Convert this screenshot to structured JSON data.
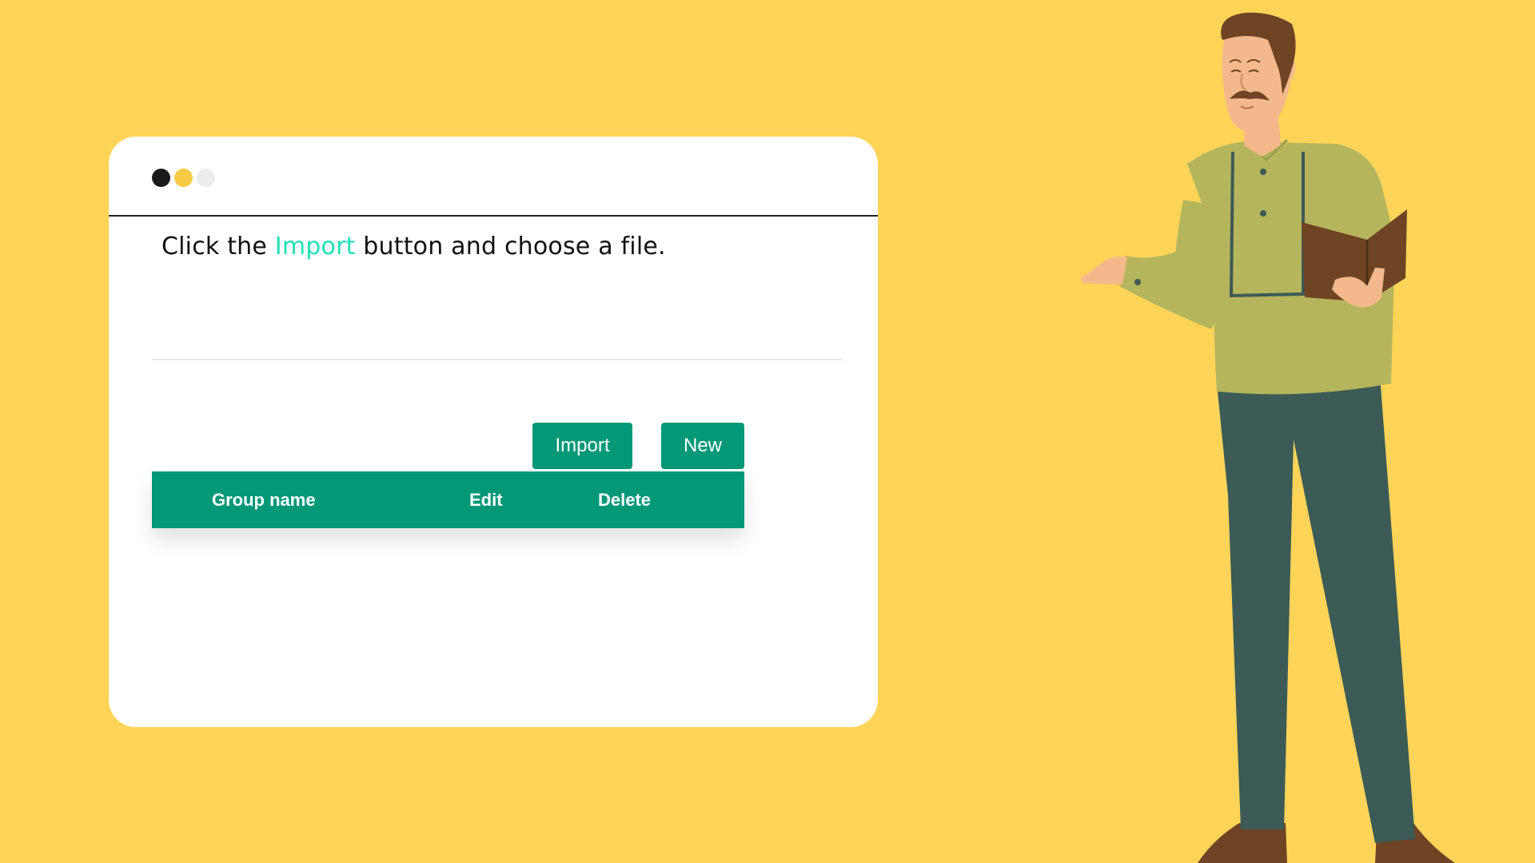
{
  "instruction": {
    "before": "Click the ",
    "highlight": "Import",
    "after": " button and choose a file."
  },
  "buttons": {
    "import_label": "Import",
    "new_label": "New"
  },
  "table": {
    "columns": [
      "Group name",
      "Edit",
      "Delete"
    ]
  },
  "colors": {
    "background": "#FDD458",
    "primary": "#039877",
    "highlight": "#1EE0B6",
    "dot_1": "#1a1a1a",
    "dot_2": "#F7CB45",
    "dot_3": "#ececec"
  }
}
